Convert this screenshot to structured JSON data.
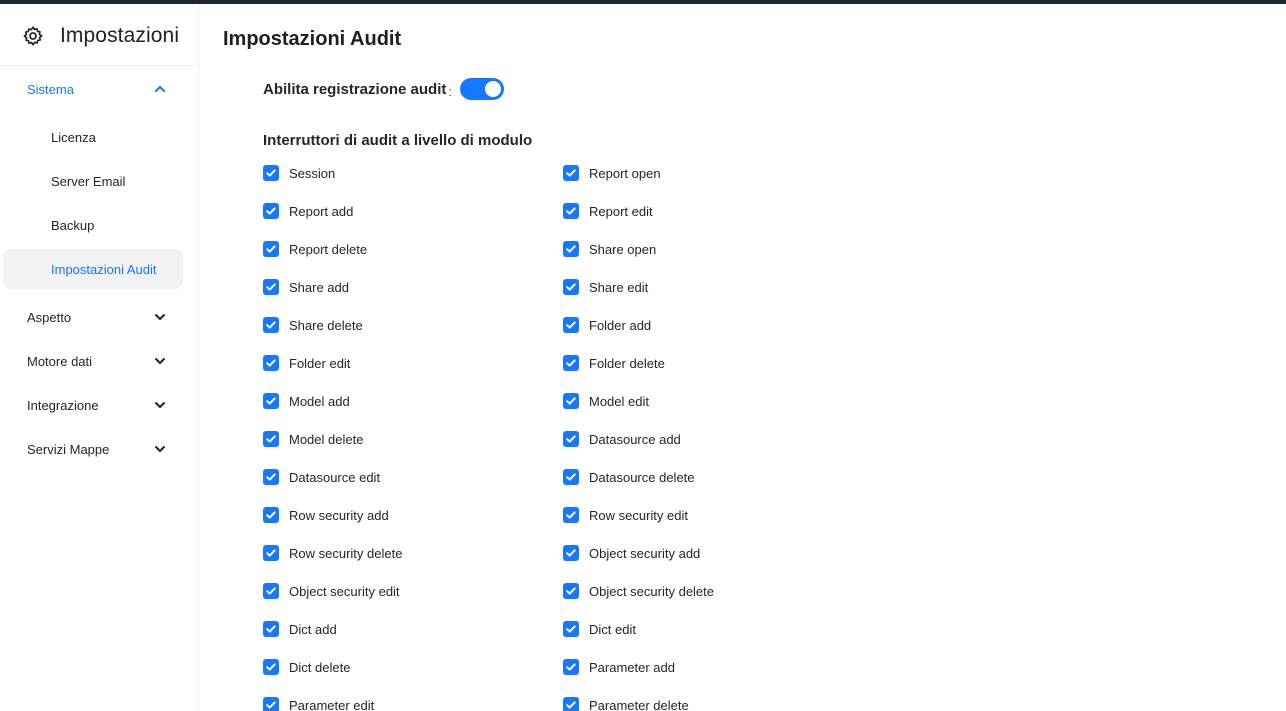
{
  "sidebar": {
    "title": "Impostazioni",
    "groups": [
      {
        "label": "Sistema",
        "state": "expanded",
        "children": [
          {
            "label": "Licenza"
          },
          {
            "label": "Server Email"
          },
          {
            "label": "Backup"
          },
          {
            "label": "Impostazioni Audit",
            "selected": true
          }
        ]
      },
      {
        "label": "Aspetto",
        "state": "collapsed"
      },
      {
        "label": "Motore dati",
        "state": "collapsed"
      },
      {
        "label": "Integrazione",
        "state": "collapsed"
      },
      {
        "label": "Servizi Mappe",
        "state": "collapsed"
      }
    ]
  },
  "main": {
    "title": "Impostazioni Audit",
    "enable_audit": {
      "label": "Abilita registrazione audit",
      "colon": ":",
      "value": true
    },
    "module_switches": {
      "title": "Interruttori di audit a livello di modulo",
      "items": [
        {
          "label": "Session",
          "checked": true
        },
        {
          "label": "Report open",
          "checked": true
        },
        {
          "label": "Report add",
          "checked": true
        },
        {
          "label": "Report edit",
          "checked": true
        },
        {
          "label": "Report delete",
          "checked": true
        },
        {
          "label": "Share open",
          "checked": true
        },
        {
          "label": "Share add",
          "checked": true
        },
        {
          "label": "Share edit",
          "checked": true
        },
        {
          "label": "Share delete",
          "checked": true
        },
        {
          "label": "Folder add",
          "checked": true
        },
        {
          "label": "Folder edit",
          "checked": true
        },
        {
          "label": "Folder delete",
          "checked": true
        },
        {
          "label": "Model add",
          "checked": true
        },
        {
          "label": "Model edit",
          "checked": true
        },
        {
          "label": "Model delete",
          "checked": true
        },
        {
          "label": "Datasource add",
          "checked": true
        },
        {
          "label": "Datasource edit",
          "checked": true
        },
        {
          "label": "Datasource delete",
          "checked": true
        },
        {
          "label": "Row security add",
          "checked": true
        },
        {
          "label": "Row security edit",
          "checked": true
        },
        {
          "label": "Row security delete",
          "checked": true
        },
        {
          "label": "Object security add",
          "checked": true
        },
        {
          "label": "Object security edit",
          "checked": true
        },
        {
          "label": "Object security delete",
          "checked": true
        },
        {
          "label": "Dict add",
          "checked": true
        },
        {
          "label": "Dict edit",
          "checked": true
        },
        {
          "label": "Dict delete",
          "checked": true
        },
        {
          "label": "Parameter add",
          "checked": true
        },
        {
          "label": "Parameter edit",
          "checked": true
        },
        {
          "label": "Parameter delete",
          "checked": true
        }
      ]
    }
  },
  "colors": {
    "accent": "#1677ff",
    "topbar": "#1f2430",
    "selected_bg": "#f2f2f3"
  },
  "icons": {
    "brand": "gear-icon",
    "expanded": "chevron-up-icon",
    "collapsed": "chevron-down-icon",
    "checkbox": "check-icon"
  }
}
